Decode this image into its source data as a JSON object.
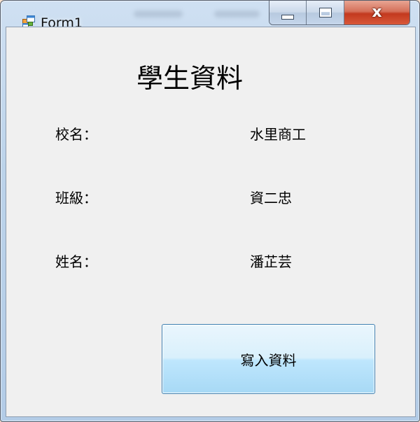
{
  "window": {
    "title": "Form1",
    "app_icon": "windows-form-icon",
    "minimize_icon": "minimize-icon",
    "maximize_icon": "maximize-icon",
    "close_icon": "close-icon",
    "close_glyph": "x"
  },
  "form": {
    "heading": "學生資料",
    "fields": [
      {
        "label": "校名：",
        "value": "水里商工"
      },
      {
        "label": "班級：",
        "value": "資二忠"
      },
      {
        "label": "姓名：",
        "value": "潘芷芸"
      }
    ],
    "write_button_label": "寫入資料"
  },
  "colors": {
    "client_background": "#f0f0f0",
    "frame_blue": "#b3cce7",
    "close_red": "#c3391e",
    "button_border": "#3c7fb1"
  }
}
